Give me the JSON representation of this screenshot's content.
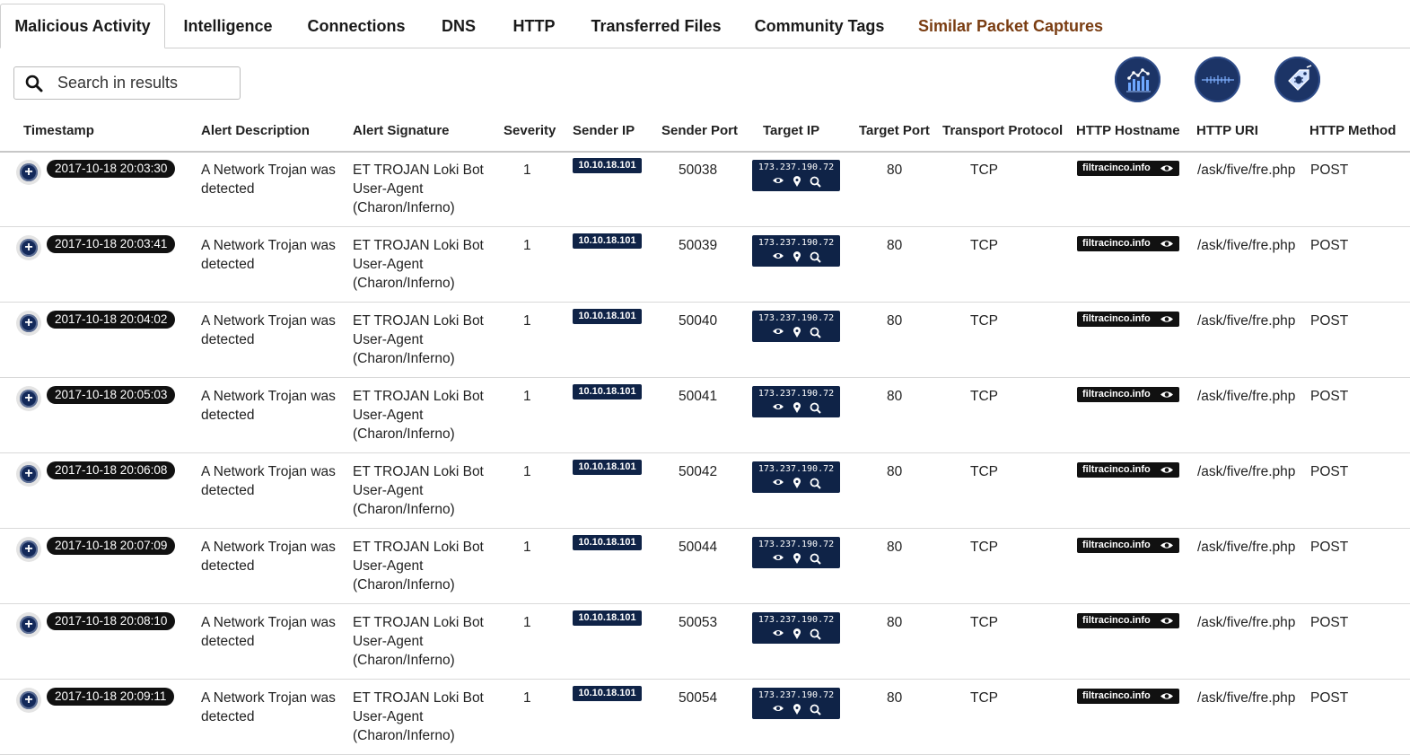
{
  "tabs": [
    {
      "label": "Malicious Activity",
      "active": true
    },
    {
      "label": "Intelligence"
    },
    {
      "label": "Connections"
    },
    {
      "label": "DNS"
    },
    {
      "label": "HTTP"
    },
    {
      "label": "Transferred Files"
    },
    {
      "label": "Community Tags"
    },
    {
      "label": "Similar Packet Captures",
      "special": true
    }
  ],
  "search": {
    "placeholder": "Search in results",
    "value": ""
  },
  "tools": [
    "chart-analytics-icon",
    "waveform-icon",
    "bug-tag-icon"
  ],
  "colors": {
    "navy": "#0f2347",
    "tab_special": "#7a3d12",
    "badge": "#111111"
  },
  "columns": [
    "Timestamp",
    "Alert Description",
    "Alert Signature",
    "Severity",
    "Sender IP",
    "Sender Port",
    "Target IP",
    "Target Port",
    "Transport Protocol",
    "HTTP Hostname",
    "HTTP URI",
    "HTTP Method"
  ],
  "rows": [
    {
      "timestamp": "2017-10-18 20:03:30",
      "desc1": "A Network Trojan was",
      "desc2": "detected",
      "sig1": "ET TROJAN Loki Bot",
      "sig2": "User-Agent",
      "sig3": "(Charon/Inferno)",
      "severity": "1",
      "sender_ip": "10.10.18.101",
      "sender_port": "50038",
      "target_ip": "173.237.190.72",
      "target_port": "80",
      "protocol": "TCP",
      "hostname": "filtracinco.info",
      "uri": "/ask/five/fre.php",
      "method": "POST"
    },
    {
      "timestamp": "2017-10-18 20:03:41",
      "desc1": "A Network Trojan was",
      "desc2": "detected",
      "sig1": "ET TROJAN Loki Bot",
      "sig2": "User-Agent",
      "sig3": "(Charon/Inferno)",
      "severity": "1",
      "sender_ip": "10.10.18.101",
      "sender_port": "50039",
      "target_ip": "173.237.190.72",
      "target_port": "80",
      "protocol": "TCP",
      "hostname": "filtracinco.info",
      "uri": "/ask/five/fre.php",
      "method": "POST"
    },
    {
      "timestamp": "2017-10-18 20:04:02",
      "desc1": "A Network Trojan was",
      "desc2": "detected",
      "sig1": "ET TROJAN Loki Bot",
      "sig2": "User-Agent",
      "sig3": "(Charon/Inferno)",
      "severity": "1",
      "sender_ip": "10.10.18.101",
      "sender_port": "50040",
      "target_ip": "173.237.190.72",
      "target_port": "80",
      "protocol": "TCP",
      "hostname": "filtracinco.info",
      "uri": "/ask/five/fre.php",
      "method": "POST"
    },
    {
      "timestamp": "2017-10-18 20:05:03",
      "desc1": "A Network Trojan was",
      "desc2": "detected",
      "sig1": "ET TROJAN Loki Bot",
      "sig2": "User-Agent",
      "sig3": "(Charon/Inferno)",
      "severity": "1",
      "sender_ip": "10.10.18.101",
      "sender_port": "50041",
      "target_ip": "173.237.190.72",
      "target_port": "80",
      "protocol": "TCP",
      "hostname": "filtracinco.info",
      "uri": "/ask/five/fre.php",
      "method": "POST"
    },
    {
      "timestamp": "2017-10-18 20:06:08",
      "desc1": "A Network Trojan was",
      "desc2": "detected",
      "sig1": "ET TROJAN Loki Bot",
      "sig2": "User-Agent",
      "sig3": "(Charon/Inferno)",
      "severity": "1",
      "sender_ip": "10.10.18.101",
      "sender_port": "50042",
      "target_ip": "173.237.190.72",
      "target_port": "80",
      "protocol": "TCP",
      "hostname": "filtracinco.info",
      "uri": "/ask/five/fre.php",
      "method": "POST"
    },
    {
      "timestamp": "2017-10-18 20:07:09",
      "desc1": "A Network Trojan was",
      "desc2": "detected",
      "sig1": "ET TROJAN Loki Bot",
      "sig2": "User-Agent",
      "sig3": "(Charon/Inferno)",
      "severity": "1",
      "sender_ip": "10.10.18.101",
      "sender_port": "50044",
      "target_ip": "173.237.190.72",
      "target_port": "80",
      "protocol": "TCP",
      "hostname": "filtracinco.info",
      "uri": "/ask/five/fre.php",
      "method": "POST"
    },
    {
      "timestamp": "2017-10-18 20:08:10",
      "desc1": "A Network Trojan was",
      "desc2": "detected",
      "sig1": "ET TROJAN Loki Bot",
      "sig2": "User-Agent",
      "sig3": "(Charon/Inferno)",
      "severity": "1",
      "sender_ip": "10.10.18.101",
      "sender_port": "50053",
      "target_ip": "173.237.190.72",
      "target_port": "80",
      "protocol": "TCP",
      "hostname": "filtracinco.info",
      "uri": "/ask/five/fre.php",
      "method": "POST"
    },
    {
      "timestamp": "2017-10-18 20:09:11",
      "desc1": "A Network Trojan was",
      "desc2": "detected",
      "sig1": "ET TROJAN Loki Bot",
      "sig2": "User-Agent",
      "sig3": "(Charon/Inferno)",
      "severity": "1",
      "sender_ip": "10.10.18.101",
      "sender_port": "50054",
      "target_ip": "173.237.190.72",
      "target_port": "80",
      "protocol": "TCP",
      "hostname": "filtracinco.info",
      "uri": "/ask/five/fre.php",
      "method": "POST"
    }
  ]
}
